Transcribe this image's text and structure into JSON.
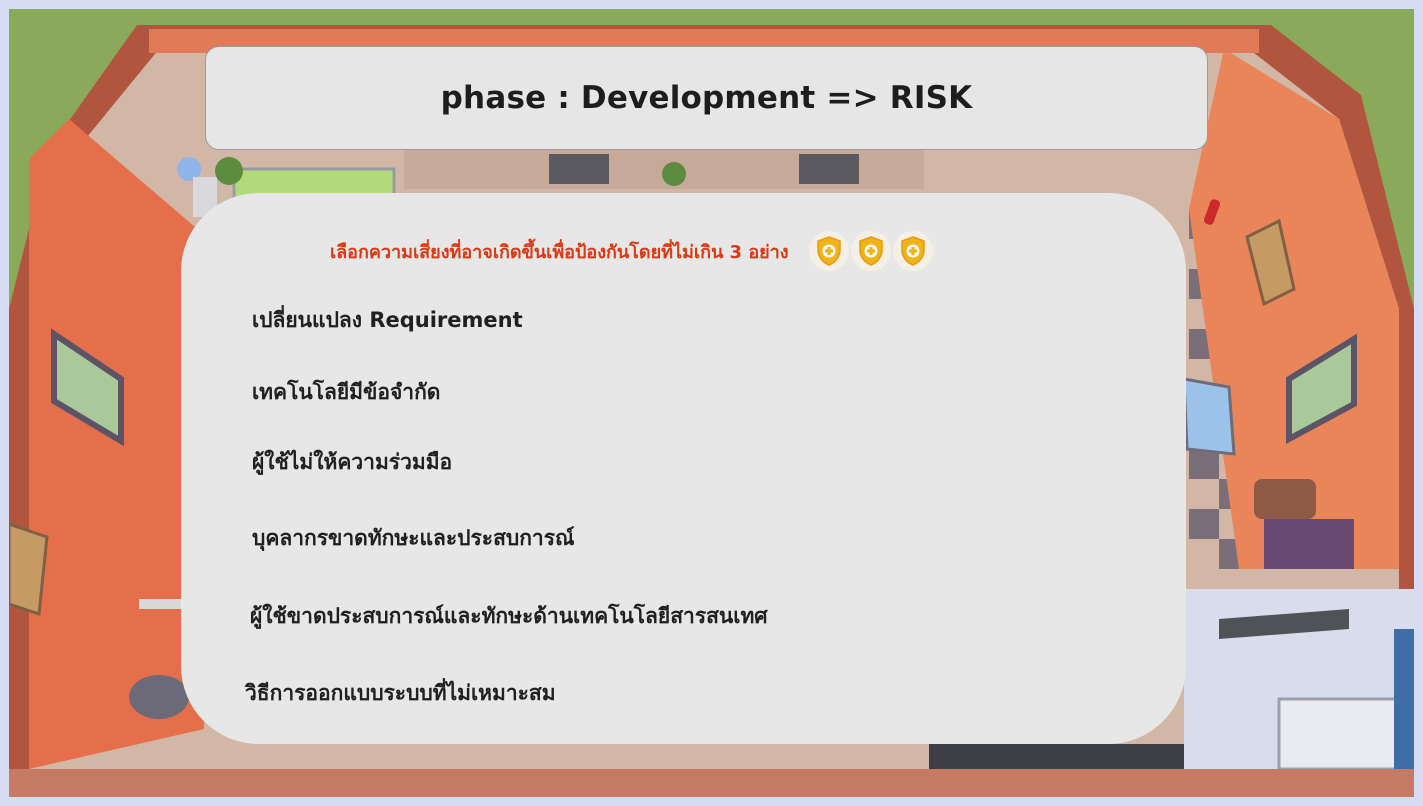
{
  "header": {
    "title": "phase : Development => RISK"
  },
  "panel": {
    "instruction": "เลือกความเสี่ยงที่อาจเกิดขึ้นเพื่อป้องกันโดยที่ไม่เกิน 3 อย่าง",
    "shields": [
      {
        "icon": "shield-icon",
        "color": "#f2b318"
      },
      {
        "icon": "shield-icon",
        "color": "#f2b318"
      },
      {
        "icon": "shield-icon",
        "color": "#f2b318"
      }
    ],
    "options": [
      "เปลี่ยนแปลง Requirement",
      "เทคโนโลยีมีข้อจำกัด",
      "ผู้ใช้ไม่ให้ความร่วมมือ",
      "บุคลากรขาดทักษะและประสบการณ์",
      "ผู้ใช้ขาดประสบการณ์และทักษะด้านเทคโนโลยีสารสนเทศ",
      "วิธีการออกแบบระบบที่ไม่เหมาะสม"
    ]
  },
  "colors": {
    "instruction": "#d93a14",
    "panel_bg": "#e7e7e7",
    "wall": "#e8805a",
    "grass": "#8aa95a"
  }
}
